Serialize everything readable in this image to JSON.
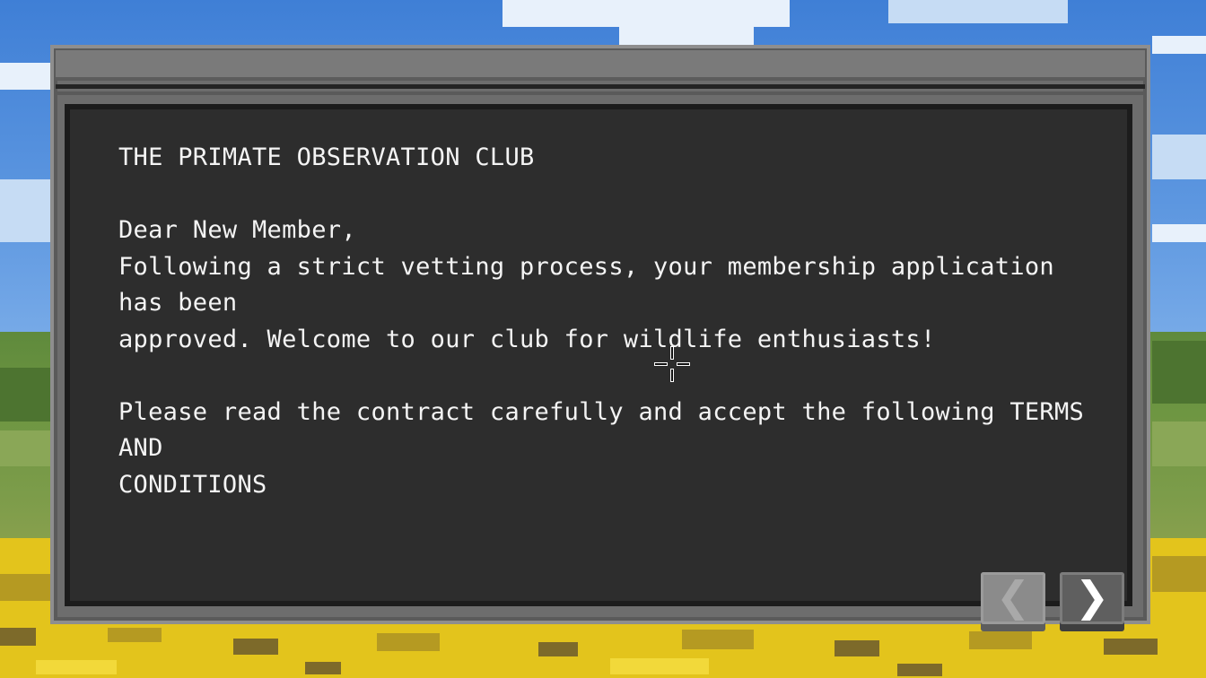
{
  "dialog": {
    "lines": [
      "THE PRIMATE OBSERVATION CLUB",
      "Dear New Member,",
      "Following a strict vetting process, your membership application has been",
      "approved. Welcome to our club for wildlife enthusiasts!",
      "Please read the contract carefully and accept the following TERMS AND",
      "CONDITIONS"
    ]
  },
  "navigation": {
    "prev_icon": "chevron-left-icon",
    "next_icon": "chevron-right-icon",
    "prev_glyph": "❮",
    "next_glyph": "❯",
    "prev_enabled": false,
    "next_enabled": true
  },
  "colors": {
    "screen_bg": "#2d2d2d",
    "text": "#f4f4f4",
    "frame": "#6d6d6d",
    "field": "#e3c41c",
    "sky": "#4a86d8"
  }
}
